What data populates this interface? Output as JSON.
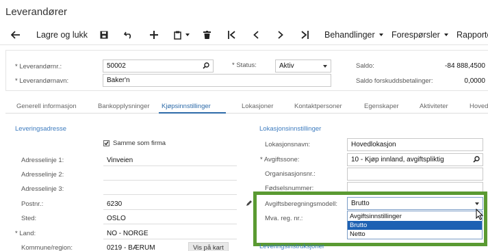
{
  "page": {
    "title": "Leverandører"
  },
  "toolbar": {
    "save_close": "Lagre og lukk",
    "behandlinger": "Behandlinger",
    "foresporsler": "Forespørsler",
    "rapporter": "Rapporte"
  },
  "summary": {
    "vendor_no_label": "Leverandørnr.:",
    "vendor_no": "50002",
    "status_label": "Status:",
    "status": "Aktiv",
    "saldo_label": "Saldo:",
    "saldo": "-84 888,4500",
    "vendor_name_label": "Leverandørnavn:",
    "vendor_name": "Baker'n",
    "prepay_label": "Saldo forskuddsbetalinger:",
    "prepay": "0,0000"
  },
  "tabs": [
    "Generell informasjon",
    "Bankopplysninger",
    "Kjøpsinnstillinger",
    "Lokasjoner",
    "Kontaktpersoner",
    "Egenskaper",
    "Aktiviteter",
    "Hoved"
  ],
  "active_tab": "Kjøpsinnstillinger",
  "left": {
    "section_title": "Leveringsadresse",
    "same_as_company": "Samme som firma",
    "addr1_label": "Adresselinje 1:",
    "addr1": "Vinveien",
    "addr2_label": "Adresselinje 2:",
    "addr2": "",
    "addr3_label": "Adresselinje 3:",
    "addr3": "",
    "postnr_label": "Postnr.:",
    "postnr": "6230",
    "sted_label": "Sted:",
    "sted": "OSLO",
    "land_label": "Land:",
    "land": "NO - NORGE",
    "kommune_label": "Kommune/region:",
    "kommune": "0219 - BÆRUM",
    "map_button": "Vis på kart"
  },
  "right": {
    "section_title": "Lokasjonsinnstillinger",
    "location_name_label": "Lokasjonsnavn:",
    "location_name": "Hovedlokasjon",
    "tax_zone_label": "Avgiftssone:",
    "tax_zone": "10 - Kjøp innland, avgiftspliktig",
    "org_label": "Organisasjonsnr.:",
    "birth_label": "Fødselsnummer:",
    "tax_model_label": "Avgiftsberegningsmodell:",
    "tax_model": "Brutto",
    "vat_label": "Mva. reg. nr.:",
    "delivery_section": "Leveringsinstruksjoner",
    "options": [
      "Avgiftsinnstillinger",
      "Brutto",
      "Netto"
    ],
    "selected_option": "Brutto"
  },
  "colors": {
    "accent": "#2c6aa8",
    "highlight_frame": "#5a9a32",
    "selected_option": "#1d61b3"
  }
}
